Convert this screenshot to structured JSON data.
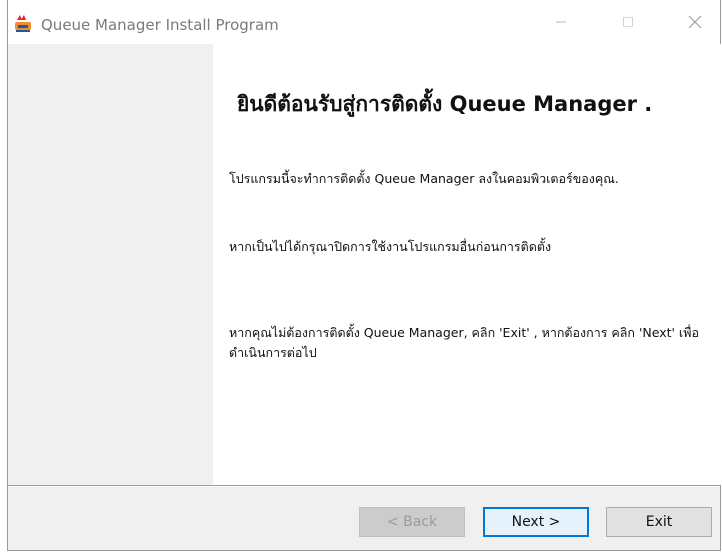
{
  "window": {
    "title": "Queue Manager Install Program",
    "controls": {
      "minimize_icon": "minimize-icon",
      "maximize_icon": "maximize-icon",
      "close_icon": "close-icon"
    }
  },
  "content": {
    "heading": "ยินดีต้อนรับสู่การติดตั้ง Queue Manager .",
    "paragraph1": "โปรแกรมนี้จะทำการติดตั้ง Queue Manager ลงในคอมพิวเตอร์ของคุณ.",
    "paragraph2": "หากเป็นไปได้กรุณาปิดการใช้งานโปรแกรมอื่นก่อนการติดตั้ง",
    "paragraph3": "หากคุณไม่ต้องการติดตั้ง Queue Manager, คลิก 'Exit' , หากต้องการ คลิก 'Next' เพื่อดำเนินการต่อไป"
  },
  "buttons": {
    "back": "< Back",
    "next": "Next >",
    "exit": "Exit"
  },
  "colors": {
    "accent": "#0078d7",
    "panel": "#f0f0f0"
  }
}
